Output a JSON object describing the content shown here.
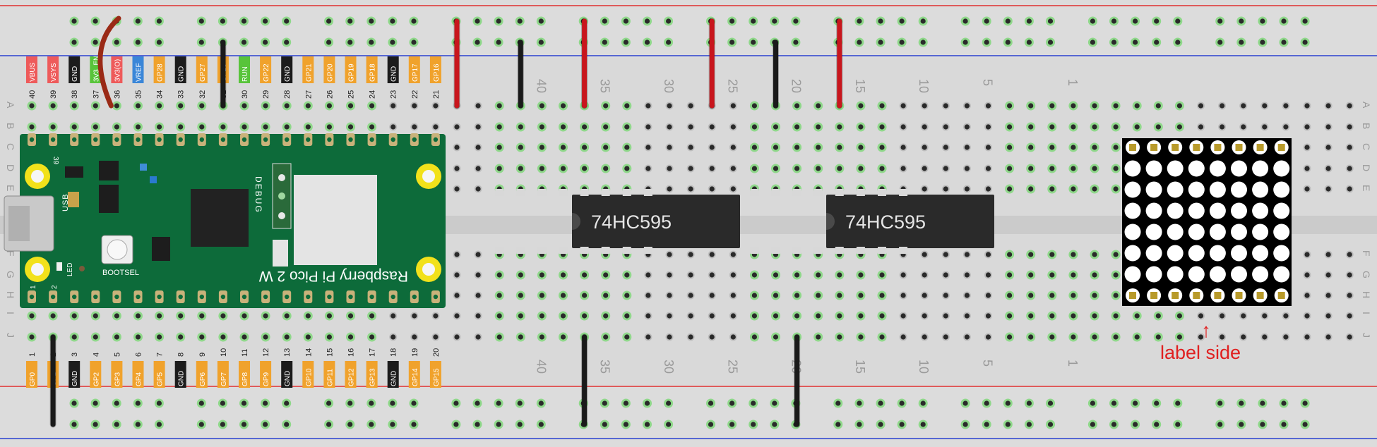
{
  "board": {
    "title": "Raspberry Pi Pico 2 W",
    "usb_label": "USB",
    "debug_label": "DEBUG",
    "led_label": "LED",
    "bootsel_label": "BOOTSEL",
    "corner_pin_top": "39",
    "corner_pin_bottom_1": "1",
    "corner_pin_bottom_2": "2"
  },
  "top_pins": [
    {
      "num": "40",
      "label": "VBUS",
      "color": "#ee5a5a"
    },
    {
      "num": "39",
      "label": "VSYS",
      "color": "#ee5a5a"
    },
    {
      "num": "38",
      "label": "GND",
      "color": "#1c1c1c"
    },
    {
      "num": "37",
      "label": "3V3_EN",
      "color": "#58c43a"
    },
    {
      "num": "36",
      "label": "3V3(O)",
      "color": "#ee5a5a"
    },
    {
      "num": "35",
      "label": "VREF",
      "color": "#3a86d8"
    },
    {
      "num": "34",
      "label": "GP28",
      "color": "#f0a22c"
    },
    {
      "num": "33",
      "label": "GND",
      "color": "#1c1c1c"
    },
    {
      "num": "32",
      "label": "GP27",
      "color": "#f0a22c"
    },
    {
      "num": "31",
      "label": "GP26",
      "color": "#f0a22c"
    },
    {
      "num": "30",
      "label": "RUN",
      "color": "#58c43a"
    },
    {
      "num": "29",
      "label": "GP22",
      "color": "#f0a22c"
    },
    {
      "num": "28",
      "label": "GND",
      "color": "#1c1c1c"
    },
    {
      "num": "27",
      "label": "GP21",
      "color": "#f0a22c"
    },
    {
      "num": "26",
      "label": "GP20",
      "color": "#f0a22c"
    },
    {
      "num": "25",
      "label": "GP19",
      "color": "#f0a22c"
    },
    {
      "num": "24",
      "label": "GP18",
      "color": "#f0a22c"
    },
    {
      "num": "23",
      "label": "GND",
      "color": "#1c1c1c"
    },
    {
      "num": "22",
      "label": "GP17",
      "color": "#f0a22c"
    },
    {
      "num": "21",
      "label": "GP16",
      "color": "#f0a22c"
    }
  ],
  "bottom_pins": [
    {
      "num": "1",
      "label": "GP0",
      "color": "#f0a22c"
    },
    {
      "num": "2",
      "label": "GP1",
      "color": "#f0a22c"
    },
    {
      "num": "3",
      "label": "GND",
      "color": "#1c1c1c"
    },
    {
      "num": "4",
      "label": "GP2",
      "color": "#f0a22c"
    },
    {
      "num": "5",
      "label": "GP3",
      "color": "#f0a22c"
    },
    {
      "num": "6",
      "label": "GP4",
      "color": "#f0a22c"
    },
    {
      "num": "7",
      "label": "GP5",
      "color": "#f0a22c"
    },
    {
      "num": "8",
      "label": "GND",
      "color": "#1c1c1c"
    },
    {
      "num": "9",
      "label": "GP6",
      "color": "#f0a22c"
    },
    {
      "num": "10",
      "label": "GP7",
      "color": "#f0a22c"
    },
    {
      "num": "11",
      "label": "GP8",
      "color": "#f0a22c"
    },
    {
      "num": "12",
      "label": "GP9",
      "color": "#f0a22c"
    },
    {
      "num": "13",
      "label": "GND",
      "color": "#1c1c1c"
    },
    {
      "num": "14",
      "label": "GP10",
      "color": "#f0a22c"
    },
    {
      "num": "15",
      "label": "GP11",
      "color": "#f0a22c"
    },
    {
      "num": "16",
      "label": "GP12",
      "color": "#f0a22c"
    },
    {
      "num": "17",
      "label": "GP13",
      "color": "#f0a22c"
    },
    {
      "num": "18",
      "label": "GND",
      "color": "#1c1c1c"
    },
    {
      "num": "19",
      "label": "GP14",
      "color": "#f0a22c"
    },
    {
      "num": "20",
      "label": "GP15",
      "color": "#f0a22c"
    }
  ],
  "breadboard": {
    "row_letters_top": [
      "A",
      "B",
      "C",
      "D",
      "E"
    ],
    "row_letters_bottom": [
      "F",
      "G",
      "H",
      "I",
      "J"
    ],
    "column_numbers": [
      "40",
      "35",
      "30",
      "25",
      "20",
      "15",
      "10",
      "5",
      "1"
    ]
  },
  "chips": [
    {
      "label": "74HC595"
    },
    {
      "label": "74HC595"
    }
  ],
  "annotation": {
    "text": "label side",
    "arrow": "↑"
  },
  "colors": {
    "board_green": "#0d6b3a",
    "wire_red": "#c8161d",
    "wire_black": "#1a1a1a",
    "wire_brown": "#9a2a16",
    "rail_red": "#e03030",
    "rail_blue": "#2a40d0",
    "annotation_red": "#e02020"
  }
}
